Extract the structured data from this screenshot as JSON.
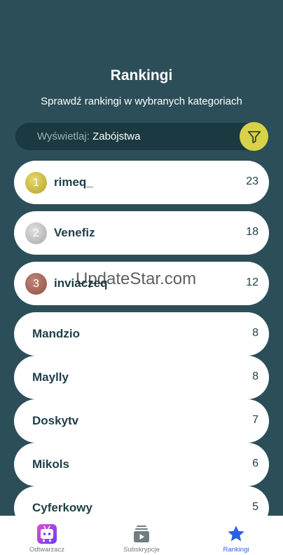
{
  "header": {
    "title": "Rankingi",
    "subtitle": "Sprawdź rankingi w wybranych kategoriach"
  },
  "filter": {
    "prefix": "Wyświetlaj:",
    "value": "Zabójstwa",
    "icon": "filter-icon",
    "button_color": "#d8d14a"
  },
  "rankings": [
    {
      "rank": "1",
      "name": "rimeq_",
      "score": "23",
      "medal_color": "#c6b63c"
    },
    {
      "rank": "2",
      "name": "Venefiz",
      "score": "18",
      "medal_color": "#bdbdbd"
    },
    {
      "rank": "3",
      "name": "inviaczeq",
      "score": "12",
      "medal_color": "#a9685a"
    },
    {
      "name": "Mandzio",
      "score": "8"
    },
    {
      "name": "Maylly",
      "score": "8"
    },
    {
      "name": "Doskytv",
      "score": "7"
    },
    {
      "name": "Mikols",
      "score": "6"
    },
    {
      "name": "Cyferkowy",
      "score": "5"
    }
  ],
  "watermark": "UpdateStar.com",
  "tabs": [
    {
      "label": "Odtwarzacz",
      "icon": "player-tv-icon",
      "active": false
    },
    {
      "label": "Subskrypcje",
      "icon": "subscriptions-icon",
      "active": false
    },
    {
      "label": "Rankingi",
      "icon": "star-icon",
      "active": true
    }
  ],
  "colors": {
    "background": "#2c4e58",
    "text_dark": "#1e3e47",
    "active_tab": "#2a5fe3"
  }
}
